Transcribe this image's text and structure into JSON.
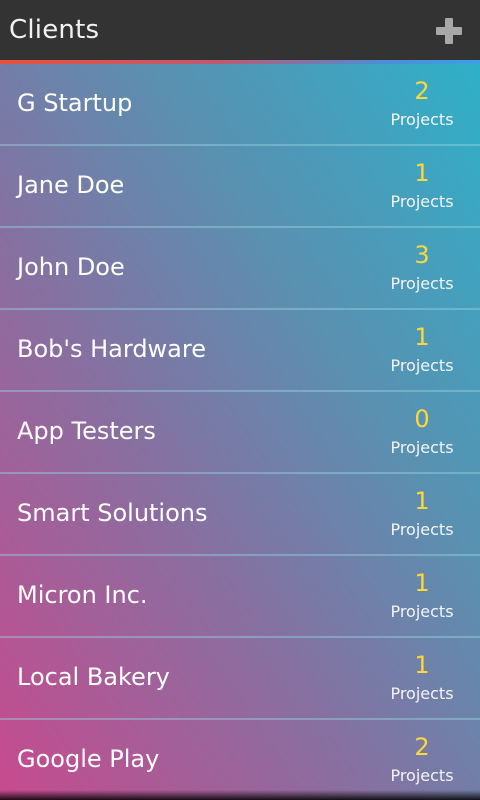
{
  "header": {
    "title": "Clients",
    "add_icon": "plus-icon",
    "background_color": "#333333",
    "accent_gradient": [
      "#e8513a",
      "#3ba0e6"
    ]
  },
  "clients": [
    {
      "name": "G Startup",
      "projects": "2",
      "projects_label": "Projects"
    },
    {
      "name": "Jane Doe",
      "projects": "1",
      "projects_label": "Projects"
    },
    {
      "name": "John Doe",
      "projects": "3",
      "projects_label": "Projects"
    },
    {
      "name": "Bob's Hardware",
      "projects": "1",
      "projects_label": "Projects"
    },
    {
      "name": "App Testers",
      "projects": "0",
      "projects_label": "Projects"
    },
    {
      "name": "Smart Solutions",
      "projects": "1",
      "projects_label": "Projects"
    },
    {
      "name": "Micron Inc.",
      "projects": "1",
      "projects_label": "Projects"
    },
    {
      "name": "Local Bakery",
      "projects": "1",
      "projects_label": "Projects"
    },
    {
      "name": "Google Play",
      "projects": "2",
      "projects_label": "Projects"
    }
  ],
  "colors": {
    "count_color": "#ffd73a",
    "list_gradient_top": "#2fb0c9",
    "list_gradient_bottom": "#c84a8e"
  }
}
